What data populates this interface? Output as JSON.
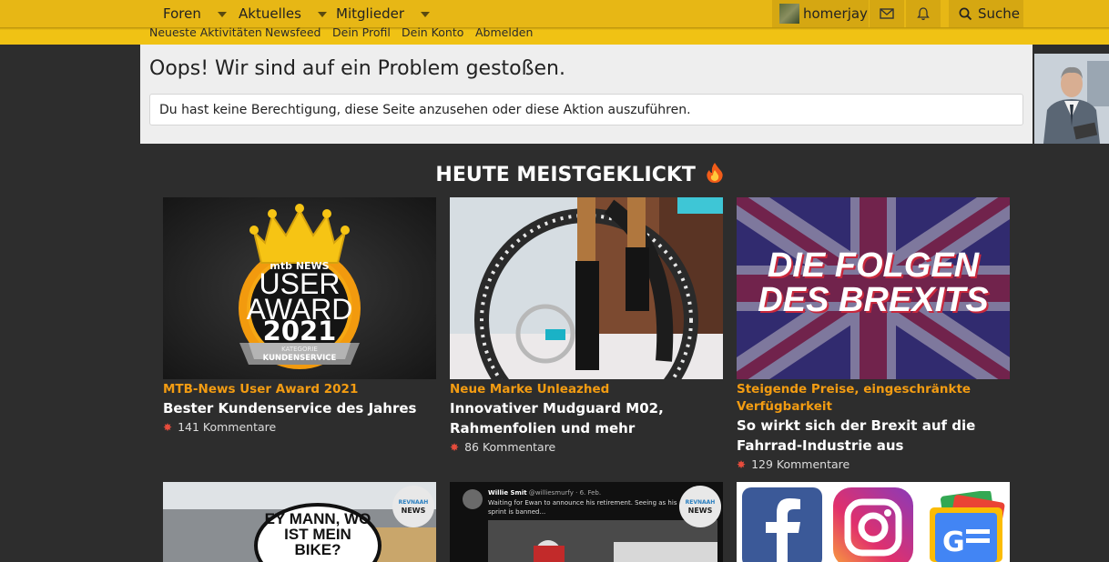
{
  "nav": {
    "items": [
      {
        "label": "Foren"
      },
      {
        "label": "Aktuelles"
      },
      {
        "label": "Mitglieder"
      }
    ],
    "username": "homerjay",
    "search_label": "Suche"
  },
  "subnav": {
    "links": [
      "Neueste Aktivitäten",
      "Newsfeed",
      "Dein Profil",
      "Dein Konto",
      "Abmelden"
    ]
  },
  "error": {
    "title": "Oops! Wir sind auf ein Problem gestoßen.",
    "message": "Du hast keine Berechtigung, diese Seite anzusehen oder diese Aktion auszuführen."
  },
  "section": {
    "title": "HEUTE MEISTGEKLICKT",
    "title_icon": "fire-icon"
  },
  "articles": [
    {
      "kicker": "MTB-News User Award 2021",
      "headline": "Bester Kundenservice des Jahres",
      "comments": "141 Kommentare",
      "image": {
        "brand": "mtb NEWS",
        "line1": "USER",
        "line2": "AWARD",
        "year": "2021",
        "category": "KATEGORIE",
        "category_value": "KUNDENSERVICE"
      }
    },
    {
      "kicker": "Neue Marke Unleazhed",
      "headline": "Innovativer Mudguard M02, Rahmenfolien und mehr",
      "comments": "86 Kommentare"
    },
    {
      "kicker": "Steigende Preise, eingeschränkte Verfügbarkeit",
      "headline": "So wirkt sich der Brexit auf die Fahrrad-Industrie aus",
      "comments": "129 Kommentare",
      "image": {
        "line1": "DIE FOLGEN",
        "line2": "DES BREXITS"
      }
    }
  ],
  "bottom_cards": [
    {
      "badge_top": "REVNAAH",
      "badge": "NEWS",
      "bubble": "EY MANN, WO IST MEIN BIKE?"
    },
    {
      "badge_top": "REVNAAH",
      "badge": "NEWS",
      "tweet_user": "Willie Smit",
      "tweet_handle": "@williesmurfy · 6. Feb.",
      "tweet_text": "Waiting for Ewan to announce his retirement. Seeing as his sprint is banned..."
    },
    {
      "logos": [
        "facebook-icon",
        "instagram-icon",
        "google-news-icon"
      ]
    }
  ],
  "colors": {
    "topbar": "#e7b715",
    "accent_kicker": "#f39c12",
    "background": "#2d2d2d"
  }
}
